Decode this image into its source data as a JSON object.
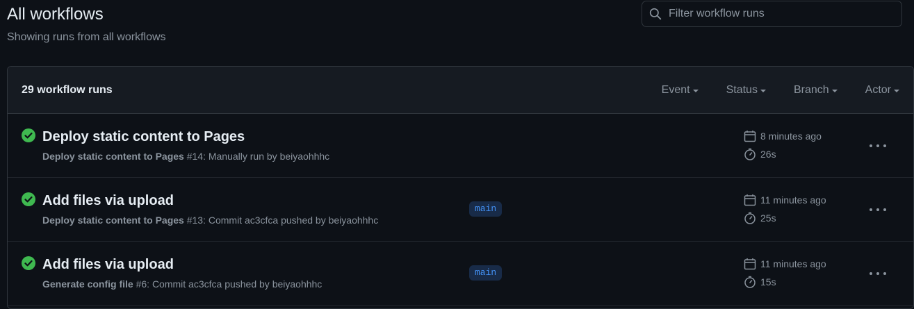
{
  "header": {
    "title": "All workflows",
    "subtitle": "Showing runs from all workflows"
  },
  "search": {
    "placeholder": "Filter workflow runs",
    "icon": "search-icon"
  },
  "list": {
    "count_label": "29 workflow runs",
    "filters": [
      "Event",
      "Status",
      "Branch",
      "Actor"
    ]
  },
  "runs": [
    {
      "status": "success",
      "title": "Deploy static content to Pages",
      "workflow": "Deploy static content to Pages",
      "detail": " #14: Manually run by beiyaohhhc",
      "branch": "",
      "time": "8 minutes ago",
      "duration": "26s"
    },
    {
      "status": "success",
      "title": "Add files via upload",
      "workflow": "Deploy static content to Pages",
      "detail": " #13: Commit ac3cfca pushed by beiyaohhhc",
      "branch": "main",
      "time": "11 minutes ago",
      "duration": "25s"
    },
    {
      "status": "success",
      "title": "Add files via upload",
      "workflow": "Generate config file",
      "detail": " #6: Commit ac3cfca pushed by beiyaohhhc",
      "branch": "main",
      "time": "11 minutes ago",
      "duration": "15s"
    }
  ],
  "colors": {
    "background": "#0d1117",
    "header_bg": "#161b22",
    "success": "#3fb950",
    "branch_bg": "#182b48",
    "branch_fg": "#4493f8",
    "muted": "#8b949e"
  }
}
